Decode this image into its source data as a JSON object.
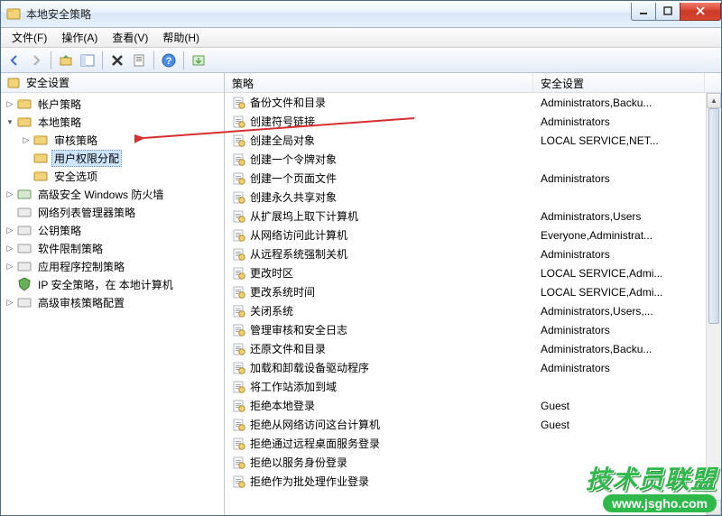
{
  "window": {
    "title": "本地安全策略"
  },
  "menu": {
    "file": "文件(F)",
    "action": "操作(A)",
    "view": "查看(V)",
    "help": "帮助(H)"
  },
  "tree": {
    "root": "安全设置",
    "account": "帐户策略",
    "local": "本地策略",
    "audit": "审核策略",
    "userrights": "用户权限分配",
    "secoptions": "安全选项",
    "firewall": "高级安全 Windows 防火墙",
    "netlist": "网络列表管理器策略",
    "pubkey": "公钥策略",
    "software": "软件限制策略",
    "appctrl": "应用程序控制策略",
    "ipsec": "IP 安全策略，在 本地计算机",
    "advaudit": "高级审核策略配置"
  },
  "columns": {
    "policy": "策略",
    "setting": "安全设置"
  },
  "policies": [
    {
      "name": "备份文件和目录",
      "setting": "Administrators,Backu..."
    },
    {
      "name": "创建符号链接",
      "setting": "Administrators"
    },
    {
      "name": "创建全局对象",
      "setting": "LOCAL SERVICE,NET..."
    },
    {
      "name": "创建一个令牌对象",
      "setting": ""
    },
    {
      "name": "创建一个页面文件",
      "setting": "Administrators"
    },
    {
      "name": "创建永久共享对象",
      "setting": ""
    },
    {
      "name": "从扩展坞上取下计算机",
      "setting": "Administrators,Users"
    },
    {
      "name": "从网络访问此计算机",
      "setting": "Everyone,Administrat..."
    },
    {
      "name": "从远程系统强制关机",
      "setting": "Administrators"
    },
    {
      "name": "更改时区",
      "setting": "LOCAL SERVICE,Admi..."
    },
    {
      "name": "更改系统时间",
      "setting": "LOCAL SERVICE,Admi..."
    },
    {
      "name": "关闭系统",
      "setting": "Administrators,Users,..."
    },
    {
      "name": "管理审核和安全日志",
      "setting": "Administrators"
    },
    {
      "name": "还原文件和目录",
      "setting": "Administrators,Backu..."
    },
    {
      "name": "加载和卸载设备驱动程序",
      "setting": "Administrators"
    },
    {
      "name": "将工作站添加到域",
      "setting": ""
    },
    {
      "name": "拒绝本地登录",
      "setting": "Guest"
    },
    {
      "name": "拒绝从网络访问这台计算机",
      "setting": "Guest"
    },
    {
      "name": "拒绝通过远程桌面服务登录",
      "setting": ""
    },
    {
      "name": "拒绝以服务身份登录",
      "setting": ""
    },
    {
      "name": "拒绝作为批处理作业登录",
      "setting": ""
    }
  ],
  "watermark": {
    "text": "技术员联盟",
    "url": "www.jsgho.com"
  }
}
